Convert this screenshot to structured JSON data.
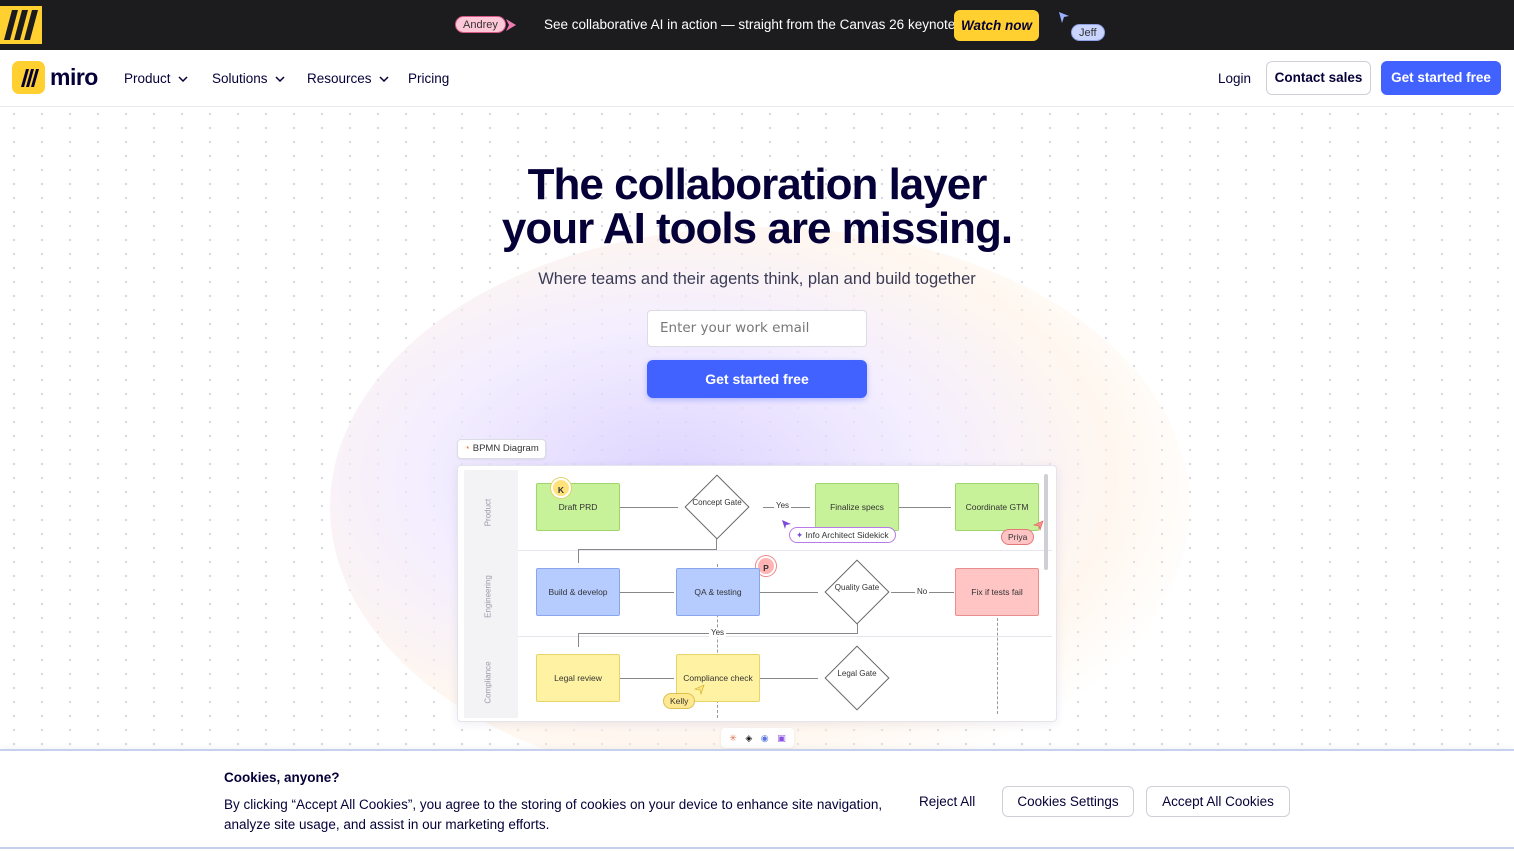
{
  "announcement": {
    "message": "See collaborative AI in action — straight from the Canvas 26 keynote.",
    "watch_label": "Watch now",
    "cursor_andrey": "Andrey",
    "cursor_jeff": "Jeff"
  },
  "nav": {
    "brand": "miro",
    "menu": [
      {
        "label": "Product"
      },
      {
        "label": "Solutions"
      },
      {
        "label": "Resources"
      },
      {
        "label": "Pricing"
      }
    ],
    "login": "Login",
    "contact_sales": "Contact sales",
    "get_started": "Get started free"
  },
  "hero": {
    "headline_line1": "The collaboration layer",
    "headline_line2": "your AI tools are missing.",
    "subhead": "Where teams and their agents think, plan and build together",
    "email_placeholder": "Enter your work email",
    "cta": "Get started free"
  },
  "board": {
    "label": "BPMN Diagram",
    "lanes": [
      "Product",
      "Engineering",
      "Compliance"
    ],
    "nodes": {
      "draft_prd": "Draft PRD",
      "concept_gate": "Concept Gate",
      "finalize_specs": "Finalize specs",
      "coordinate_gtm": "Coordinate GTM",
      "build_develop": "Build & develop",
      "qa_testing": "QA & testing",
      "quality_gate": "Quality Gate",
      "fix_tests": "Fix if tests fail",
      "legal_review": "Legal review",
      "compliance_check": "Compliance check",
      "legal_gate": "Legal Gate"
    },
    "edge_labels": {
      "yes1": "Yes",
      "no": "No",
      "yes2": "Yes"
    },
    "avatars": {
      "k": "K",
      "p": "P"
    },
    "collaborators": {
      "priya": "Priya",
      "kelly": "Kelly",
      "sidekick": "Info Architect Sidekick"
    }
  },
  "cookie": {
    "title": "Cookies, anyone?",
    "text": "By clicking “Accept All Cookies”, you agree to the storing of cookies on your device to enhance site navigation, analyze site usage, and assist in our marketing efforts.",
    "reject": "Reject All",
    "settings": "Cookies Settings",
    "accept": "Accept All Cookies"
  },
  "colors": {
    "brand_yellow": "#ffd02f",
    "primary_blue": "#4262ff",
    "ink": "#050038",
    "announce_bg": "#1c1c1e"
  }
}
